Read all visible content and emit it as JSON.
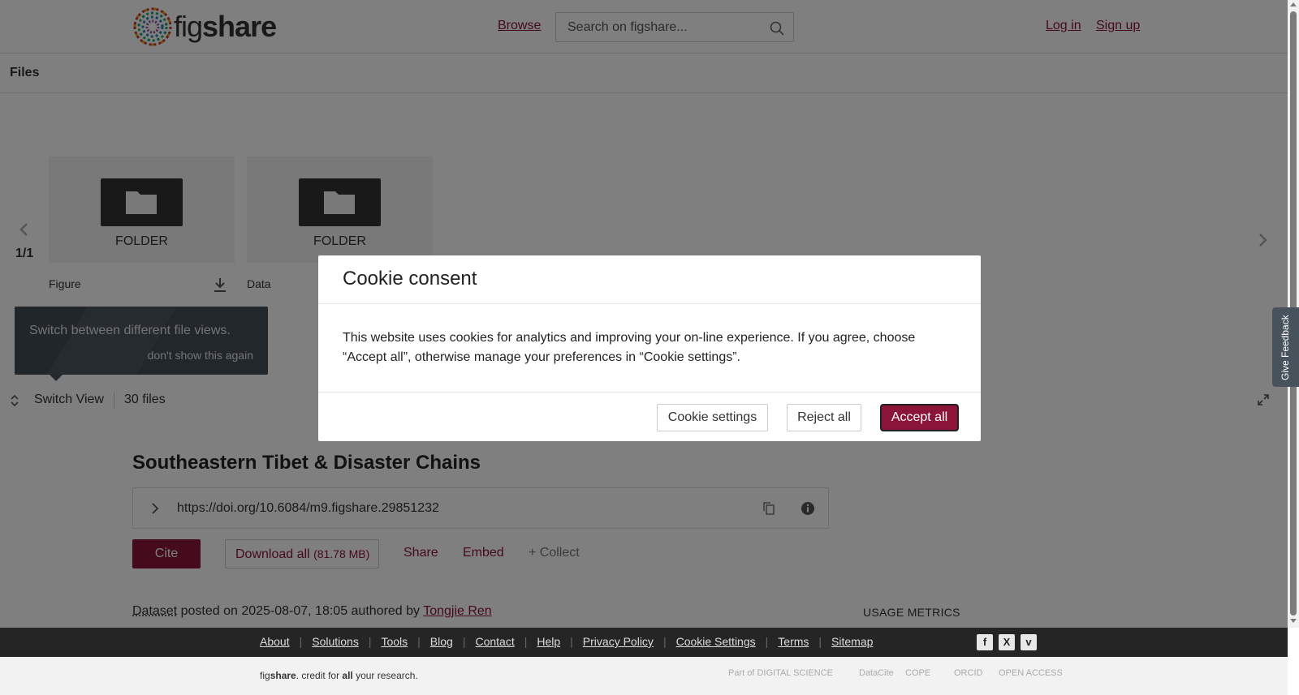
{
  "header": {
    "logo_prefix": "fig",
    "logo_suffix": "share",
    "browse_label": "Browse",
    "search_placeholder": "Search on figshare...",
    "login_label": "Log in",
    "signup_label": "Sign up"
  },
  "files": {
    "section_label": "Files",
    "pager": "1/1",
    "items": [
      {
        "type": "FOLDER",
        "name": "Figure"
      },
      {
        "type": "FOLDER",
        "name": "Data"
      }
    ],
    "tooltip_text": "Switch between different file views.",
    "tooltip_dismiss": "don't show this again",
    "switch_view_label": "Switch View",
    "file_count": "30 files"
  },
  "item": {
    "title": "Southeastern Tibet & Disaster Chains",
    "doi": "https://doi.org/10.6084/m9.figshare.29851232",
    "cite_label": "Cite",
    "download_label": "Download all",
    "download_size": "(81.78 MB)",
    "share_label": "Share",
    "embed_label": "Embed",
    "collect_label": "+ Collect",
    "meta_type": "Dataset",
    "meta_posted": " posted on 2025-08-07, 18:05 authored by ",
    "meta_author": "Tongjie Ren",
    "usage_metrics_label": "USAGE METRICS"
  },
  "footer": {
    "links": [
      "About",
      "Solutions",
      "Tools",
      "Blog",
      "Contact",
      "Help",
      "Privacy Policy",
      "Cookie Settings",
      "Terms",
      "Sitemap"
    ],
    "social": [
      "facebook-icon",
      "x-icon",
      "vimeo-icon"
    ],
    "tagline_prefix": "fig",
    "tagline_bold": "share",
    "tagline_mid": ". credit for ",
    "tagline_all": "all",
    "tagline_end": " your research.",
    "partners": [
      "Part of DIGITAL SCIENCE",
      "DataCite",
      "COPE",
      "ORCID",
      "OPEN ACCESS"
    ]
  },
  "feedback_label": "Give Feedback",
  "cookie_modal": {
    "title": "Cookie consent",
    "body": "This website uses cookies for analytics and improving your on-line experience. If you agree, choose “Accept all”, otherwise manage your preferences in “Cookie settings”.",
    "settings_label": "Cookie settings",
    "reject_label": "Reject all",
    "accept_label": "Accept all"
  },
  "colors": {
    "brand": "#8a1538",
    "footer_dark": "#252525",
    "tooltip_bg": "#48525c"
  }
}
